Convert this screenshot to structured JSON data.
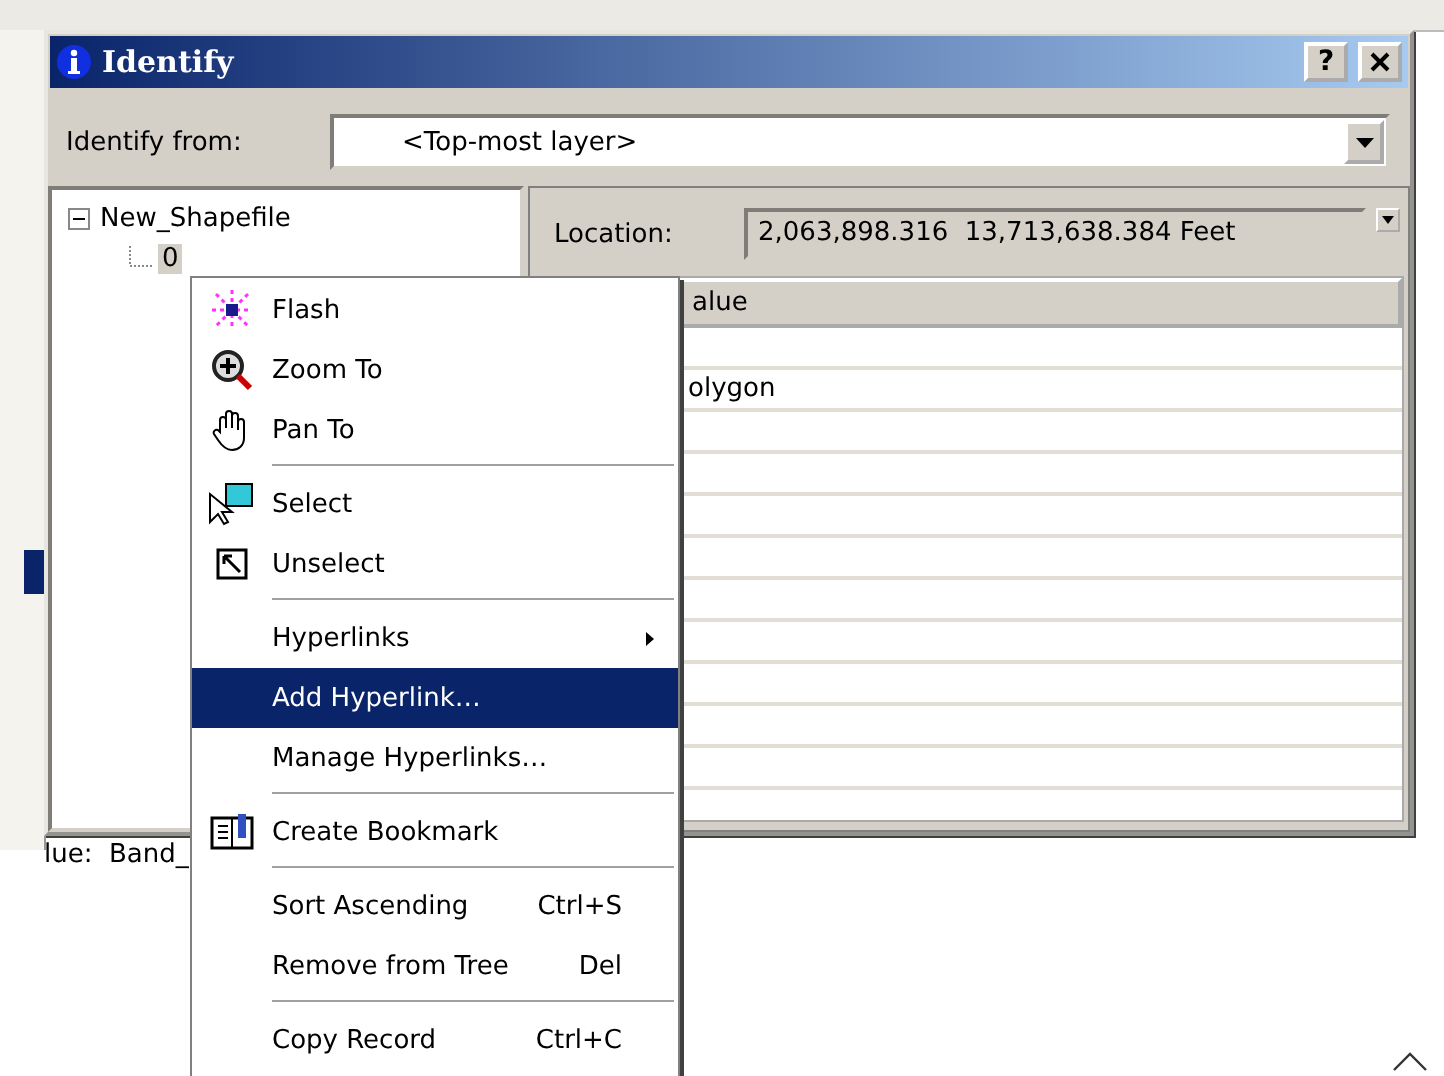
{
  "window": {
    "title": "Identify",
    "help": "?"
  },
  "identify_from": {
    "label": "Identify from:",
    "value": "<Top-most layer>"
  },
  "tree": [
    {
      "label": "New_Shapefile",
      "expanded": true,
      "selected": false,
      "children": [
        {
          "label": "0",
          "selected": true
        }
      ]
    }
  ],
  "location": {
    "label": "Location:",
    "value": "2,063,898.316  13,713,638.384 Feet"
  },
  "table": {
    "value_header": "alue",
    "rows": [
      {
        "kind": "blank"
      },
      {
        "kind": "text",
        "value": "olygon"
      },
      {
        "kind": "blank"
      },
      {
        "kind": "blank"
      },
      {
        "kind": "blank"
      },
      {
        "kind": "blank"
      },
      {
        "kind": "blank"
      },
      {
        "kind": "blank"
      },
      {
        "kind": "blank"
      },
      {
        "kind": "blank"
      },
      {
        "kind": "blank"
      }
    ]
  },
  "context_menu": {
    "items": [
      {
        "kind": "item",
        "label": "Flash",
        "selected": false
      },
      {
        "kind": "item",
        "label": "Zoom To",
        "selected": false
      },
      {
        "kind": "item",
        "label": "Pan To",
        "selected": false
      },
      {
        "kind": "separator"
      },
      {
        "kind": "item",
        "label": "Select",
        "selected": false
      },
      {
        "kind": "item",
        "label": "Unselect",
        "selected": false
      },
      {
        "kind": "separator"
      },
      {
        "kind": "submenu",
        "label": "Hyperlinks",
        "selected": false
      },
      {
        "kind": "item",
        "label": "Add Hyperlink…",
        "selected": true
      },
      {
        "kind": "item",
        "label": "Manage Hyperlinks…",
        "selected": false
      },
      {
        "kind": "separator"
      },
      {
        "kind": "item",
        "label": "Create Bookmark",
        "selected": false
      },
      {
        "kind": "separator"
      },
      {
        "kind": "item",
        "label": "Sort Ascending",
        "shortcut": "Ctrl+S",
        "selected": false
      },
      {
        "kind": "item",
        "label": "Remove from Tree",
        "shortcut": "Del",
        "selected": false
      },
      {
        "kind": "separator"
      },
      {
        "kind": "item",
        "label": "Copy Record",
        "shortcut": "Ctrl+C",
        "selected": false
      }
    ]
  },
  "background": {
    "status_text": "lue:  Band_"
  }
}
